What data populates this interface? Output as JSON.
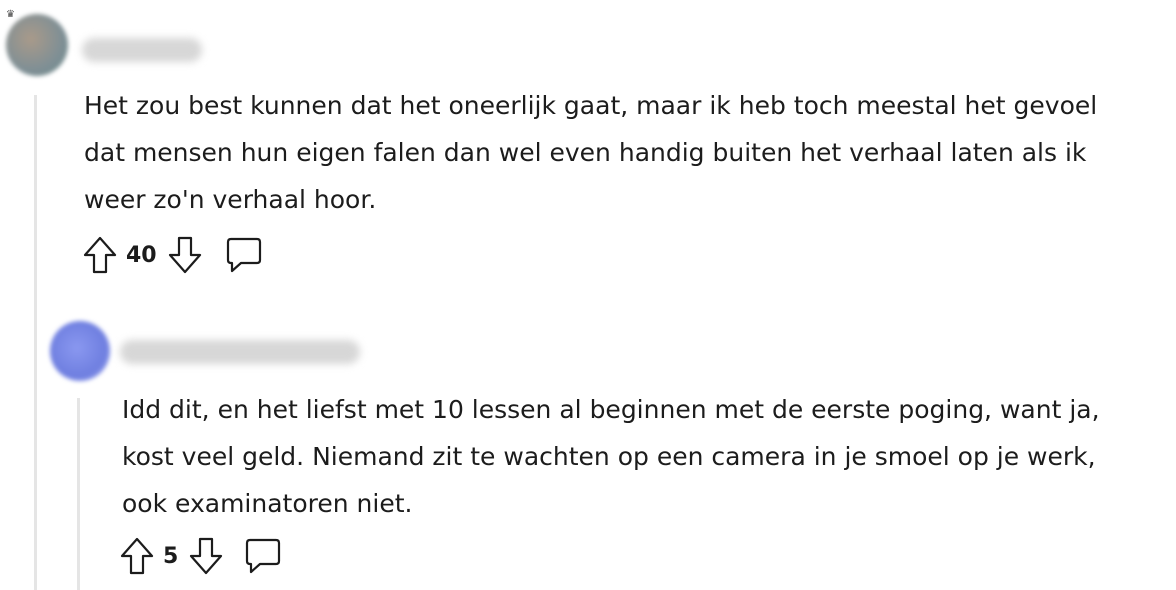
{
  "comments": [
    {
      "username": "",
      "body_lines": [
        "Het zou best kunnen dat het oneerlijk gaat, maar ik heb toch meestal het gevoel",
        "dat mensen hun eigen falen dan wel even handig buiten het verhaal laten als ik",
        "weer zo'n verhaal hoor."
      ],
      "score": "40",
      "avatar_color": "#8a9a9a"
    },
    {
      "username": "",
      "body_lines": [
        "Idd dit, en het liefst met 10 lessen al beginnen met de eerste poging, want ja,",
        "kost veel geld. Niemand zit te wachten op een camera in je smoel op je werk,",
        "ook examinatoren niet."
      ],
      "score": "5",
      "avatar_color": "#6f7fe0"
    }
  ],
  "icons": {
    "upvote": "arrow-up-outline-icon",
    "downvote": "arrow-down-outline-icon",
    "reply": "comment-bubble-icon"
  }
}
